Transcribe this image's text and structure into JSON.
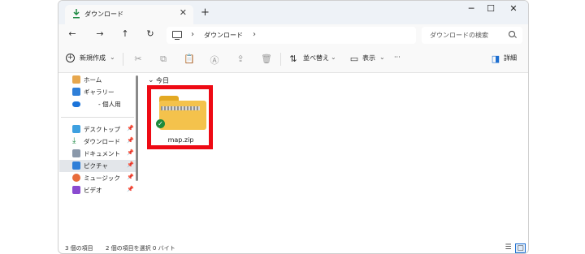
{
  "tab": {
    "title": "ダウンロード",
    "close": "✕",
    "new_tab": "+"
  },
  "window_controls": {
    "minimize": "─",
    "maximize": "☐",
    "close": "✕"
  },
  "nav": {
    "back": "←",
    "forward": "→",
    "up": "↑",
    "refresh": "↻"
  },
  "address": {
    "chev1": "›",
    "folder": "ダウンロード",
    "chev2": "›"
  },
  "search": {
    "placeholder": "ダウンロードの検索"
  },
  "toolbar": {
    "new_label": "新規作成",
    "new_chev": "⌄",
    "sort_label": "並べ替え",
    "sort_chev": "⌄",
    "view_label": "表示",
    "view_chev": "⌄",
    "more": "···",
    "details_label": "詳細"
  },
  "sidebar": {
    "items": [
      {
        "label": "ホーム"
      },
      {
        "label": "ギャラリー"
      },
      {
        "label": "- 個人用"
      },
      {
        "label": "デスクトップ"
      },
      {
        "label": "ダウンロード"
      },
      {
        "label": "ドキュメント"
      },
      {
        "label": "ピクチャ"
      },
      {
        "label": "ミュージック"
      },
      {
        "label": "ビデオ"
      }
    ],
    "pin": "📌"
  },
  "content": {
    "group_label": "今日",
    "group_chev": "⌄",
    "files": [
      {
        "name": "map.zip"
      }
    ]
  },
  "status": {
    "item_count": "3 個の項目",
    "selection": "2 個の項目を選択 0 バイト"
  },
  "colors": {
    "highlight": "#ee0a14",
    "folder": "#f4c24c",
    "accent": "#1e6fd0"
  }
}
